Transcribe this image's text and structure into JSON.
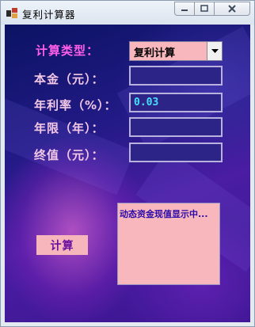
{
  "window": {
    "title": "复利计算器"
  },
  "form": {
    "type_label": "计算类型：",
    "type_value": "复利计算",
    "principal_label": "本金（元）：",
    "principal_value": "",
    "rate_label": "年利率（%）：",
    "rate_value": "0.03",
    "years_label": "年限（年）：",
    "years_value": "",
    "final_label": "终值（元）：",
    "final_value": ""
  },
  "result": {
    "text": "动态资金现值显示中..."
  },
  "buttons": {
    "calc_label": "计算"
  },
  "colors": {
    "label_accent": "#ff5fe8",
    "label_text": "#f3c8e6",
    "input_text": "#46e0ff",
    "panel_pink": "#f8b6bd",
    "button_text": "#6b10a0"
  }
}
